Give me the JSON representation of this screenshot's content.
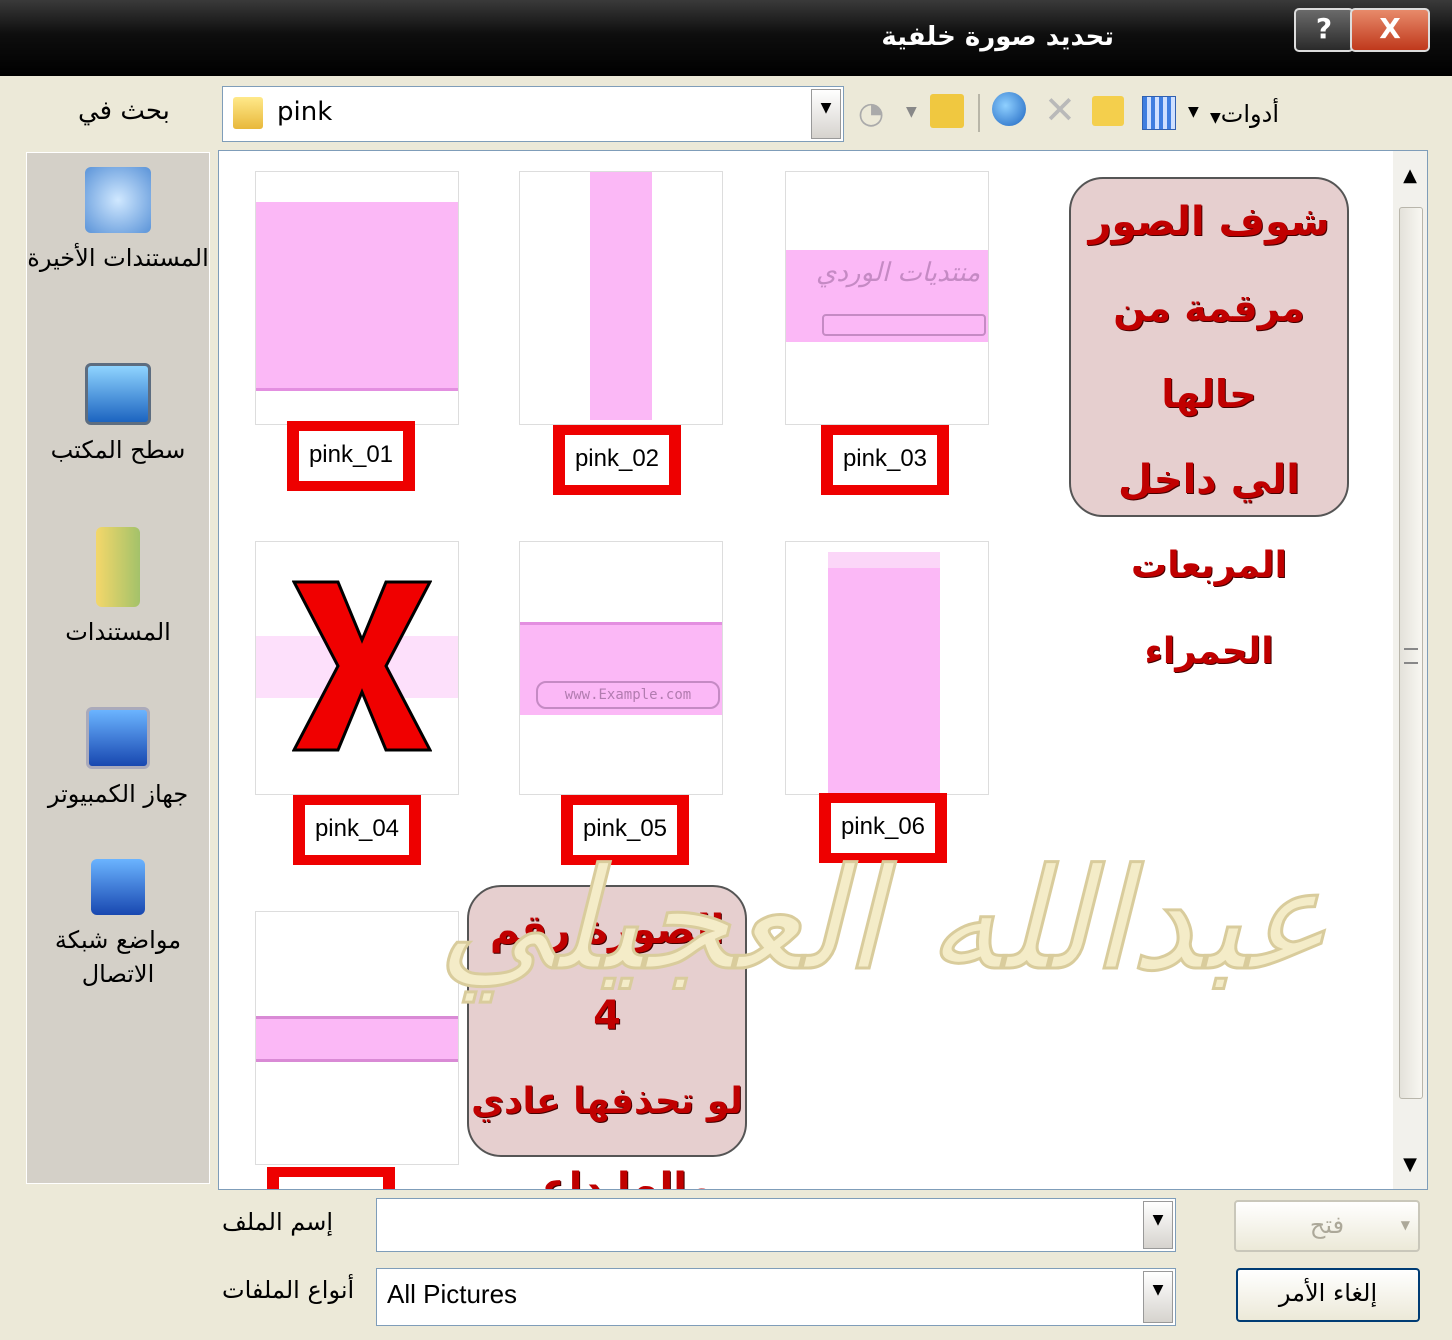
{
  "window": {
    "title": "تحديد صورة خلفية",
    "help_label": "?",
    "close_label": "X"
  },
  "lookin": {
    "label": "بحث في",
    "value": "pink",
    "tools_label": "أدوات"
  },
  "places": [
    {
      "name": "recent",
      "label": "المستندات الأخيرة"
    },
    {
      "name": "desktop",
      "label": "سطح المكتب"
    },
    {
      "name": "documents",
      "label": "المستندات"
    },
    {
      "name": "computer",
      "label": "جهاز الكمبيوتر"
    },
    {
      "name": "network",
      "label": "مواضع شبكة الاتصال"
    }
  ],
  "files": [
    {
      "label": "pink_01"
    },
    {
      "label": "pink_02"
    },
    {
      "label": "pink_03",
      "banner_text": "منتديات الوردي"
    },
    {
      "label": "pink_04"
    },
    {
      "label": "pink_05",
      "banner_text": "www.Example.com"
    },
    {
      "label": "pink_06"
    },
    {
      "label": ""
    }
  ],
  "callouts": {
    "top": [
      "شوف الصور",
      "مرقمة من حالها",
      "الي داخل",
      "المربعات الحمراء"
    ],
    "bottom": [
      "الصورة رقم 4",
      "لو تحذفها عادي",
      "مالها داعي"
    ]
  },
  "watermark": "عبدالله العجيلي",
  "footer": {
    "filename_label": "إسم الملف",
    "filename_value": "",
    "filetype_label": "أنواع الملفات",
    "filetype_value": "All Pictures",
    "open_label": "فتح",
    "cancel_label": "إلغاء الأمر"
  },
  "colors": {
    "pink": "#fbb8f6",
    "red_box": "#ee0000",
    "callout_bg": "#e6cfcf",
    "callout_text": "#c00000"
  }
}
